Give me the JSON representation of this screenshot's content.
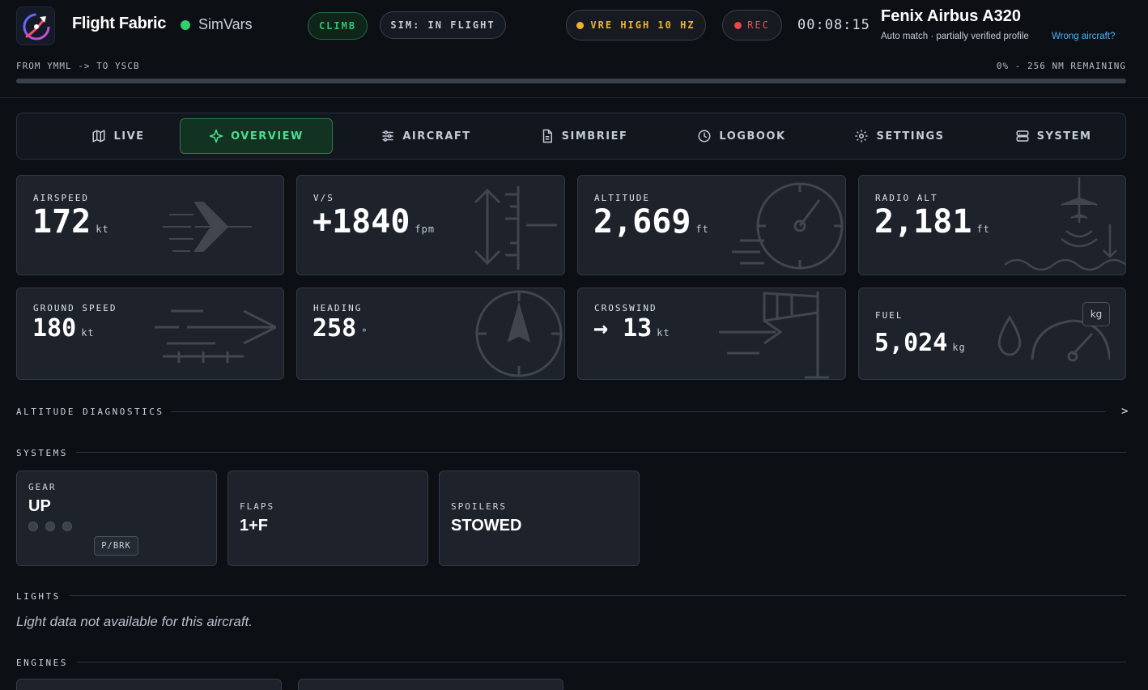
{
  "header": {
    "app_title": "Flight Fabric",
    "connection_label": "SimVars",
    "phase_badge": "CLIMB",
    "sim_status": "SIM: IN FLIGHT",
    "vre_status": "VRE HIGH 10 HZ",
    "rec_label": "REC",
    "timer": "00:08:15",
    "aircraft_name": "Fenix Airbus A320",
    "aircraft_match": "Auto match · partially verified profile",
    "wrong_aircraft_link": "Wrong aircraft?",
    "route": "FROM YMML -> TO YSCB",
    "remaining": "0% - 256 NM REMAINING",
    "progress_fraction": 0.0
  },
  "tabs": [
    {
      "label": "LIVE",
      "icon": "map-icon"
    },
    {
      "label": "OVERVIEW",
      "icon": "sparkle-icon",
      "active": true
    },
    {
      "label": "AIRCRAFT",
      "icon": "sliders-icon"
    },
    {
      "label": "SIMBRIEF",
      "icon": "document-icon"
    },
    {
      "label": "LOGBOOK",
      "icon": "clock-icon"
    },
    {
      "label": "SETTINGS",
      "icon": "gear-icon"
    },
    {
      "label": "SYSTEM",
      "icon": "server-icon"
    }
  ],
  "metrics": {
    "airspeed": {
      "label": "AIRSPEED",
      "value": "172",
      "unit": "kt"
    },
    "vs": {
      "label": "V/S",
      "value": "+1840",
      "unit": "fpm"
    },
    "altitude": {
      "label": "ALTITUDE",
      "value": "2,669",
      "unit": "ft"
    },
    "radio_alt": {
      "label": "RADIO ALT",
      "value": "2,181",
      "unit": "ft"
    },
    "ground_speed": {
      "label": "GROUND SPEED",
      "value": "180",
      "unit": "kt"
    },
    "heading": {
      "label": "HEADING",
      "value": "258",
      "unit": "°"
    },
    "crosswind": {
      "label": "CROSSWIND",
      "value": "→ 13",
      "unit": "kt"
    },
    "fuel": {
      "label": "FUEL",
      "value": "5,024",
      "unit": "kg",
      "unit_toggle": "kg"
    }
  },
  "sections": {
    "altitude_diagnostics": "ALTITUDE DIAGNOSTICS",
    "expand_glyph": ">",
    "systems": "SYSTEMS",
    "lights": "LIGHTS",
    "lights_empty": "Light data not available for this aircraft.",
    "engines": "ENGINES"
  },
  "systems": {
    "gear": {
      "label": "GEAR",
      "value": "UP",
      "brake_label": "P/BRK"
    },
    "flaps": {
      "label": "FLAPS",
      "value": "1+F"
    },
    "spoilers": {
      "label": "SPOILERS",
      "value": "STOWED"
    }
  },
  "colors": {
    "accent_green": "#4fdc8f",
    "amber": "#f0b429",
    "red": "#e5484d",
    "link_blue": "#4fb3ff"
  }
}
